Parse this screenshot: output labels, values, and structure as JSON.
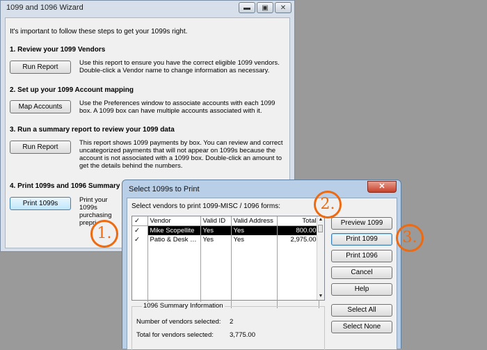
{
  "wizard": {
    "title": "1099 and 1096 Wizard",
    "intro": "It's important to follow these steps to get your 1099s right.",
    "steps": [
      {
        "heading": "1. Review your 1099 Vendors",
        "button": "Run Report",
        "desc": "Use this report to ensure you have the correct eligible 1099 vendors. Double-click a Vendor name to change information as necessary."
      },
      {
        "heading": "2. Set up your 1099 Account mapping",
        "button": "Map Accounts",
        "desc": "Use the Preferences window to associate accounts with each 1099 box. A 1099 box can have multiple accounts associated with it."
      },
      {
        "heading": "3. Run a summary report to review your 1099 data",
        "button": "Run Report",
        "desc": "This report shows 1099 payments by box. You can review and correct uncategorized payments that will not appear on 1099s because the account is not associated with a 1099 box. Double-click an amount to get the details behind the numbers."
      },
      {
        "heading": "4. Print 1099s and 1096 Summary",
        "button": "Print 1099s",
        "desc": "Print your 1099s purchasing prepri"
      }
    ],
    "window_buttons": {
      "minimize": "▬",
      "maximize": "▣",
      "close": "✕"
    }
  },
  "dialog": {
    "title": "Select 1099s to Print",
    "close": "✕",
    "instruction": "Select vendors to print 1099-MISC / 1096 forms:",
    "columns": [
      "✓",
      "Vendor",
      "Valid ID",
      "Valid Address",
      "Total"
    ],
    "rows": [
      {
        "check": "✓",
        "vendor": "Mike Scopellite",
        "valid_id": "Yes",
        "valid_address": "Yes",
        "total": "800.00"
      },
      {
        "check": "✓",
        "vendor": "Patio & Desk D...",
        "valid_id": "Yes",
        "valid_address": "Yes",
        "total": "2,975.00"
      }
    ],
    "summary": {
      "title": "1096 Summary Information",
      "count_label": "Number of vendors selected:",
      "count_value": "2",
      "total_label": "Total for vendors selected:",
      "total_value": "3,775.00"
    },
    "buttons": {
      "preview": "Preview 1099",
      "print1099": "Print 1099",
      "print1096": "Print 1096",
      "cancel": "Cancel",
      "help": "Help",
      "select_all": "Select All",
      "select_none": "Select None"
    },
    "scroll": {
      "up": "▲",
      "down": "▼"
    }
  },
  "callouts": [
    "1.",
    "2.",
    "3."
  ],
  "colors": {
    "callout": "#ee6a10",
    "desktop": "#9a9a9a",
    "selection": "#000000"
  }
}
